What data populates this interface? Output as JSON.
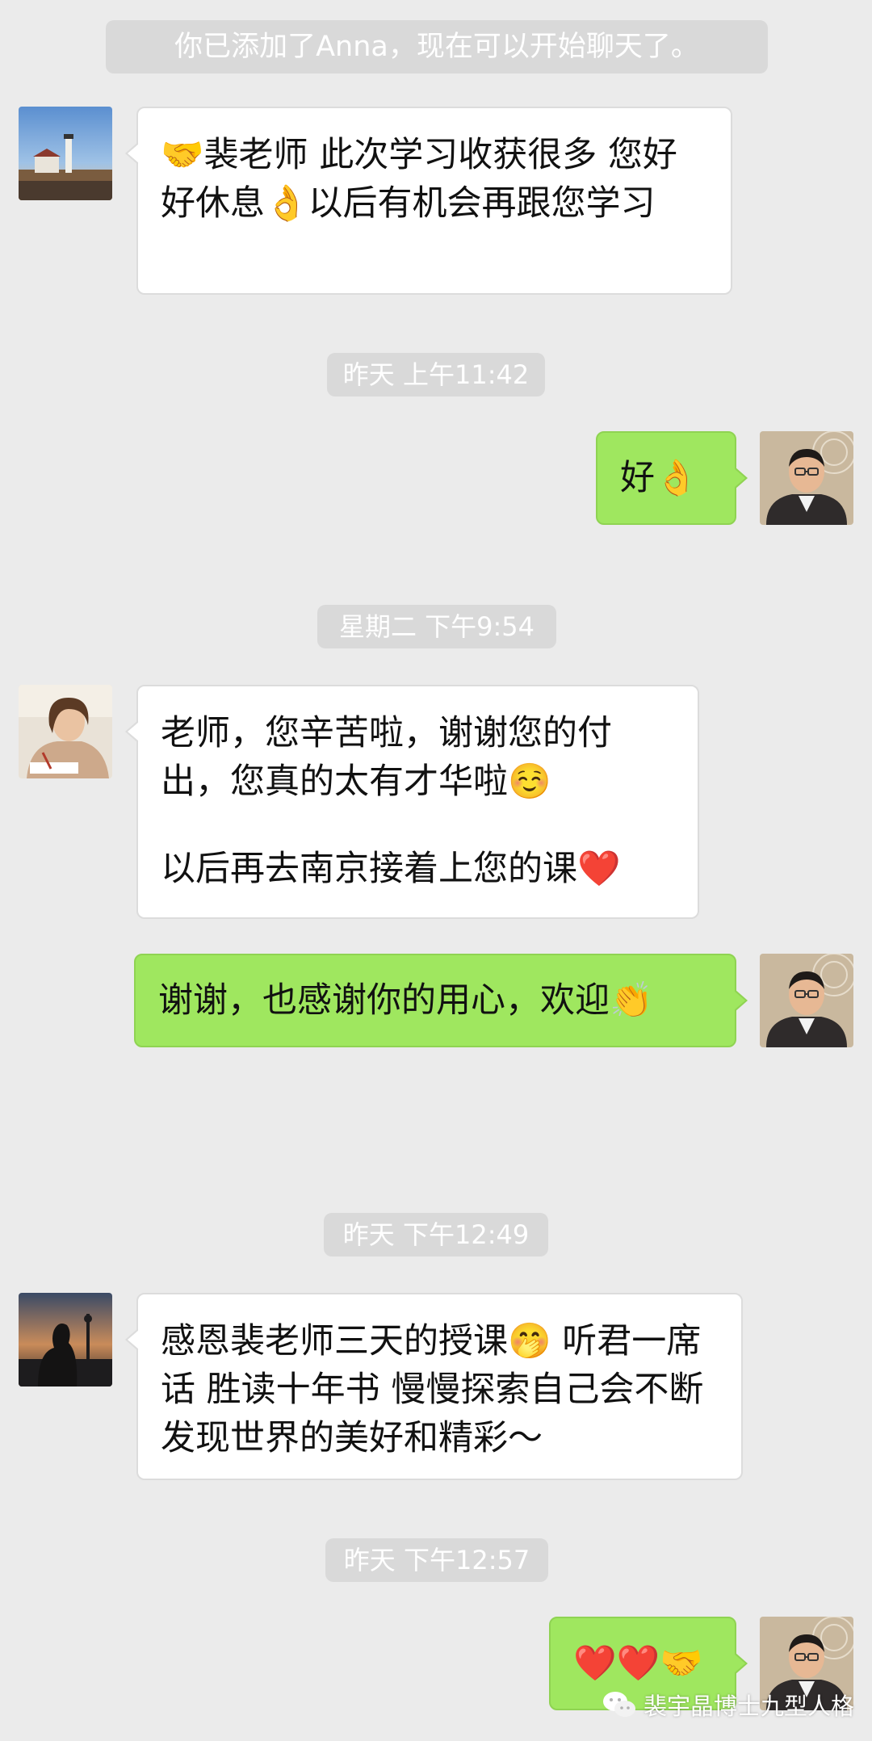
{
  "system_notice": "你已添加了Anna，现在可以开始聊天了。",
  "timestamps": [
    "昨天 上午11:42",
    "星期二 下午9:54",
    "昨天 下午12:49",
    "昨天 下午12:57"
  ],
  "messages": [
    {
      "side": "left",
      "paragraphs": [
        "🤝裴老师 此次学习收获很多 您好好休息👌以后有机会再跟您学习"
      ]
    },
    {
      "side": "right",
      "paragraphs": [
        "好👌"
      ]
    },
    {
      "side": "left",
      "paragraphs": [
        "老师，您辛苦啦，谢谢您的付出，您真的太有才华啦☺️",
        "以后再去南京接着上您的课❤️"
      ]
    },
    {
      "side": "right",
      "paragraphs": [
        "谢谢，也感谢你的用心，欢迎👏"
      ]
    },
    {
      "side": "left",
      "paragraphs": [
        "感恩裴老师三天的授课🤭 听君一席话 胜读十年书 慢慢探索自己会不断发现世界的美好和精彩～"
      ]
    },
    {
      "side": "right",
      "paragraphs": [
        "❤️❤️🤝"
      ]
    }
  ],
  "watermark": "裴宇晶博士九型人格",
  "icons": {
    "avatar_lighthouse": "lighthouse-avatar-icon",
    "avatar_teacher": "teacher-avatar-icon",
    "avatar_girl": "girl-writing-avatar-icon",
    "avatar_silhouette": "silhouette-avatar-icon",
    "watermark_logo": "wechat-logo-icon"
  },
  "colors": {
    "background": "#ebebeb",
    "left_bubble": "#ffffff",
    "right_bubble": "#9fe75f",
    "notice_pill": "#d9d9d9"
  }
}
